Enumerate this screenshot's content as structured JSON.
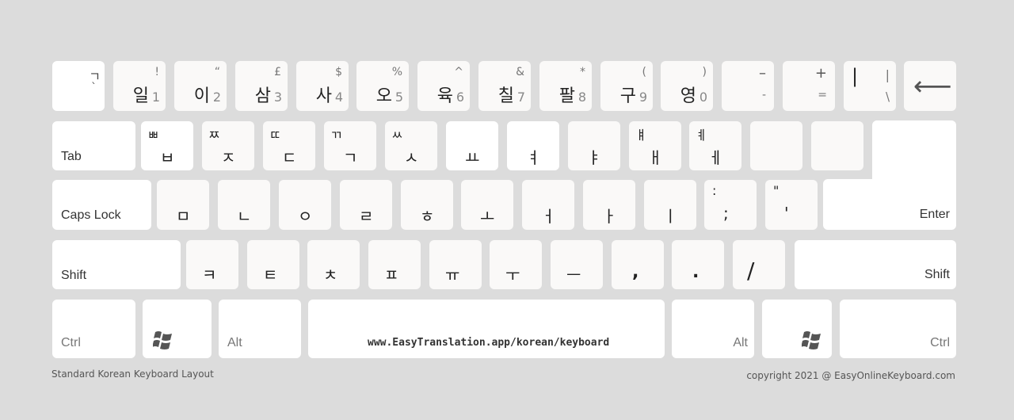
{
  "row1": [
    {
      "main": "",
      "shift": "ㄱ",
      "num": "`"
    },
    {
      "main": "일",
      "shift": "!",
      "num": "1"
    },
    {
      "main": "이",
      "shift": "“",
      "num": "2"
    },
    {
      "main": "삼",
      "shift": "£",
      "num": "3"
    },
    {
      "main": "사",
      "shift": "$",
      "num": "4"
    },
    {
      "main": "오",
      "shift": "%",
      "num": "5"
    },
    {
      "main": "육",
      "shift": "^",
      "num": "6"
    },
    {
      "main": "칠",
      "shift": "&",
      "num": "7"
    },
    {
      "main": "팔",
      "shift": "*",
      "num": "8"
    },
    {
      "main": "구",
      "shift": "(",
      "num": "9"
    },
    {
      "main": "영",
      "shift": ")",
      "num": "0"
    },
    {
      "main": "",
      "shift": "–",
      "num": "-"
    },
    {
      "main": "",
      "shift": "+",
      "num": "="
    },
    {
      "main": "|",
      "shift": "|",
      "num": "\\"
    },
    {
      "main": "⟵",
      "shift": "",
      "num": ""
    }
  ],
  "row2": [
    {
      "shift": "ㅃ",
      "main": "ㅂ"
    },
    {
      "shift": "ㅉ",
      "main": "ㅈ"
    },
    {
      "shift": "ㄸ",
      "main": "ㄷ"
    },
    {
      "shift": "ㄲ",
      "main": "ㄱ"
    },
    {
      "shift": "ㅆ",
      "main": "ㅅ"
    },
    {
      "shift": "",
      "main": "ㅛ"
    },
    {
      "shift": "",
      "main": "ㅕ"
    },
    {
      "shift": "",
      "main": "ㅑ"
    },
    {
      "shift": "ㅒ",
      "main": "ㅐ"
    },
    {
      "shift": "ㅖ",
      "main": "ㅔ"
    },
    {
      "shift": "",
      "main": ""
    },
    {
      "shift": "",
      "main": ""
    }
  ],
  "row3": [
    {
      "shift": "",
      "main": "ㅁ"
    },
    {
      "shift": "",
      "main": "ㄴ"
    },
    {
      "shift": "",
      "main": "ㅇ"
    },
    {
      "shift": "",
      "main": "ㄹ"
    },
    {
      "shift": "",
      "main": "ㅎ"
    },
    {
      "shift": "",
      "main": "ㅗ"
    },
    {
      "shift": "",
      "main": "ㅓ"
    },
    {
      "shift": "",
      "main": "ㅏ"
    },
    {
      "shift": "",
      "main": "ㅣ"
    },
    {
      "shift": ":",
      "main": ";"
    },
    {
      "shift": "\"",
      "main": "'"
    }
  ],
  "row4": [
    {
      "main": "ㅋ"
    },
    {
      "main": "ㅌ"
    },
    {
      "main": "ㅊ"
    },
    {
      "main": "ㅍ"
    },
    {
      "main": "ㅠ"
    },
    {
      "main": "ㅜ"
    },
    {
      "main": "ㅡ"
    },
    {
      "main": ","
    },
    {
      "main": "."
    },
    {
      "main": "/"
    }
  ],
  "labels": {
    "tab": "Tab",
    "caps": "Caps Lock",
    "enter": "Enter",
    "lshift": "Shift",
    "rshift": "Shift",
    "lctrl": "Ctrl",
    "lalt": "Alt",
    "ralt": "Alt",
    "rctrl": "Ctrl",
    "space": "www.EasyTranslation.app/korean/keyboard"
  },
  "footer": {
    "left": "Standard Korean Keyboard Layout",
    "right": "copyright 2021 @ EasyOnlineKeyboard.com"
  }
}
